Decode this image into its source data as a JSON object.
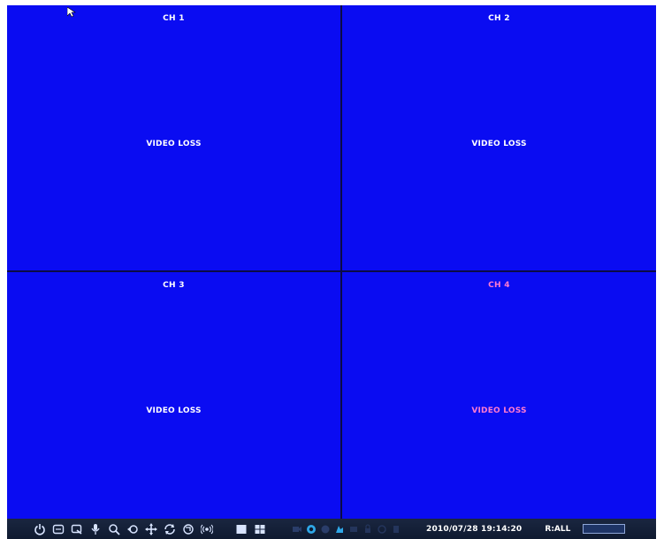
{
  "channels": [
    {
      "label": "CH 1",
      "status": "VIDEO LOSS",
      "label_color": "#ffffff",
      "status_color": "#ffffff"
    },
    {
      "label": "CH 2",
      "status": "VIDEO LOSS",
      "label_color": "#ffffff",
      "status_color": "#ffffff"
    },
    {
      "label": "CH 3",
      "status": "VIDEO LOSS",
      "label_color": "#ffffff",
      "status_color": "#ffffff"
    },
    {
      "label": "CH 4",
      "status": "VIDEO LOSS",
      "label_color": "#ff7bd0",
      "status_color": "#ff7bd0"
    }
  ],
  "colors": {
    "background": "#0a0cf2",
    "toolbar": "#142039",
    "toolbar_icon": "#d8e4ff"
  },
  "toolbar": {
    "buttons": [
      "power-icon",
      "menu-icon",
      "playback-icon",
      "audio-icon",
      "zoom-icon",
      "freeze-icon",
      "ptz-icon",
      "sequence-icon",
      "remote-icon",
      "alarm-icon"
    ],
    "layout_buttons": [
      "single-view-icon",
      "quad-view-icon"
    ],
    "status_icons": [
      "camera-status-icon",
      "network-status-icon",
      "record-status-icon",
      "motion-status-icon",
      "backup-status-icon",
      "lock-status-icon",
      "hdd-status-icon",
      "usb-status-icon"
    ],
    "datetime": "2010/07/28 19:14:20",
    "record_mode": "R:ALL"
  }
}
